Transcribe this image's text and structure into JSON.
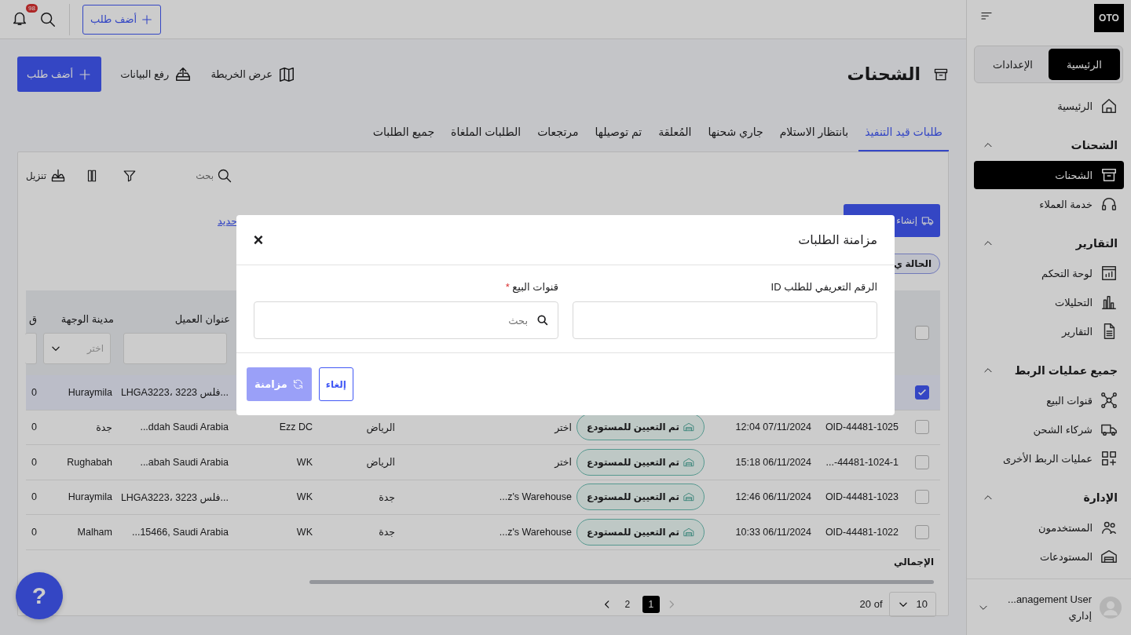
{
  "topbar": {
    "notification_count": "98",
    "add_button": "أضف طلب"
  },
  "sidebar": {
    "logo": "OTO",
    "modes": [
      {
        "label": "الرئيسية",
        "selected": true
      },
      {
        "label": "الإعدادات",
        "selected": false
      }
    ],
    "nav": [
      {
        "kind": "item",
        "label": "الرئيسية",
        "selected": false
      },
      {
        "kind": "section",
        "label": "الشحنات",
        "expanded": true
      },
      {
        "kind": "item",
        "label": "الشحنات",
        "selected": true
      },
      {
        "kind": "item",
        "label": "خدمة العملاء",
        "selected": false
      },
      {
        "kind": "section",
        "label": "التقارير",
        "expanded": true
      },
      {
        "kind": "item",
        "label": "لوحة التحكم",
        "selected": false
      },
      {
        "kind": "item",
        "label": "التحليلات",
        "selected": false
      },
      {
        "kind": "item",
        "label": "التقارير",
        "selected": false
      },
      {
        "kind": "section",
        "label": "جميع عمليات الربط",
        "expanded": true
      },
      {
        "kind": "item",
        "label": "قنوات البيع",
        "selected": false
      },
      {
        "kind": "item",
        "label": "شركاء الشحن",
        "selected": false
      },
      {
        "kind": "item",
        "label": "عمليات الربط الأخرى",
        "selected": false
      },
      {
        "kind": "section",
        "label": "الإدارة",
        "expanded": true
      },
      {
        "kind": "item",
        "label": "المستخدمون",
        "selected": false
      },
      {
        "kind": "item",
        "label": "المستودعات",
        "selected": false
      }
    ],
    "user": {
      "name": "...anagement User",
      "role": "إداري"
    }
  },
  "header": {
    "title": "الشحنات",
    "actions": [
      "عرض الخريطة",
      "رفع البيانات"
    ],
    "add_button": "أضف طلب"
  },
  "tabs": [
    {
      "label": "طلبات قيد التنفيذ",
      "selected": true
    },
    {
      "label": "بانتظار الاستلام",
      "selected": false
    },
    {
      "label": "جاري شحنها",
      "selected": false
    },
    {
      "label": "المُعلقة",
      "selected": false
    },
    {
      "label": "تم توصيلها",
      "selected": false
    },
    {
      "label": "مرتجعات",
      "selected": false
    },
    {
      "label": "الطلبات الملغاة",
      "selected": false
    },
    {
      "label": "جميع الطلبات",
      "selected": false
    }
  ],
  "toolbar": {
    "search_placeholder": "بحث",
    "download": "تنزيل",
    "create_button": "إنشاء",
    "select_link": "حديد",
    "status_chip": "الحالة ي"
  },
  "table": {
    "header_checked": false,
    "headers": {
      "address": {
        "label": "عنوان العميل"
      },
      "destination_city": {
        "label": "مدينة الوجهة",
        "placeholder": "اختر"
      },
      "column_10": {
        "label": "ق"
      }
    },
    "rows": [
      {
        "selected": true,
        "address": "LHGA3223، 3223 فلس...",
        "destination_city": "Huraymila",
        "column_10": "0"
      },
      {
        "selected": false,
        "order_id": "OID-44481-1025",
        "date": "12:04 07/11/2024",
        "status": "تم التعيين للمستودع",
        "warehouse": "اختر",
        "city": "الرياض",
        "column_7": "Ezz DC",
        "address": "...ddah Saudi Arabia",
        "destination_city": "جدة",
        "column_10": "0"
      },
      {
        "selected": false,
        "order_id": "...-44481-1024-1",
        "date": "15:18 06/11/2024",
        "status": "تم التعيين للمستودع",
        "warehouse": "اختر",
        "city": "الرياض",
        "column_7": "WK",
        "address": "...abah Saudi Arabia",
        "destination_city": "Rughabah",
        "column_10": "0"
      },
      {
        "selected": false,
        "order_id": "OID-44481-1023",
        "date": "12:46 06/11/2024",
        "status": "تم التعيين للمستودع",
        "warehouse": "...z's Warehouse",
        "city": "جدة",
        "column_7": "WK",
        "address": "LHGA3223، 3223 فلس...",
        "destination_city": "Huraymila",
        "column_10": "0"
      },
      {
        "selected": false,
        "order_id": "OID-44481-1022",
        "date": "10:33 06/11/2024",
        "status": "تم التعيين للمستودع",
        "warehouse": "...z's Warehouse",
        "city": "جدة",
        "column_7": "WK",
        "address": "...15466, Saudi Arabia",
        "destination_city": "Malham",
        "column_10": "0"
      }
    ],
    "total_label": "الإجمالي"
  },
  "pagination": {
    "per_page": "10",
    "total": "20 of",
    "prev_disabled": true,
    "pages": [
      {
        "label": "1",
        "selected": true
      },
      {
        "label": "2",
        "selected": false
      }
    ]
  },
  "help_button": "?",
  "modal": {
    "title": "مزامنة الطلبات",
    "close": "×",
    "fields": [
      {
        "kind": "text",
        "label": "الرقم التعريفي للطلب ID"
      },
      {
        "kind": "search",
        "label": "قنوات البيع",
        "required_mark": "*",
        "placeholder": "بحث"
      }
    ],
    "cancel": "إلغاء",
    "sync": {
      "label": "مزامنة",
      "disabled": true
    }
  }
}
